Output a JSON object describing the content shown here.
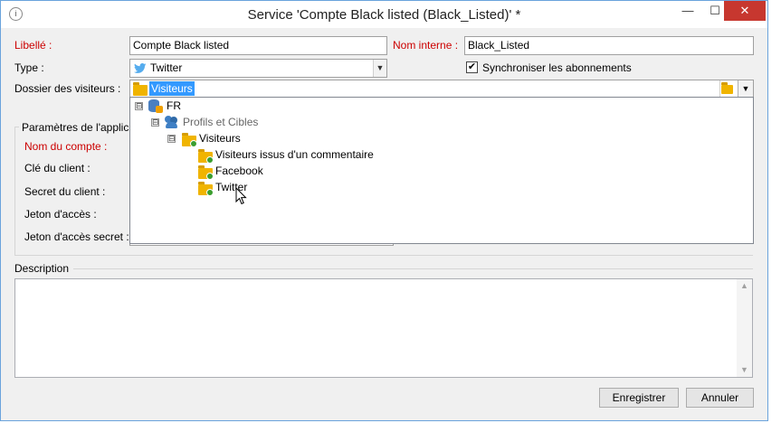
{
  "window": {
    "title": "Service 'Compte Black listed (Black_Listed)' *",
    "app_icon": "info-icon",
    "controls": {
      "minimize": "—",
      "maximize": "☐",
      "close": "✕"
    }
  },
  "form": {
    "libelle_label": "Libellé :",
    "libelle_value": "Compte Black listed",
    "nom_interne_label": "Nom interne :",
    "nom_interne_value": "Black_Listed",
    "type_label": "Type :",
    "type_value": "Twitter",
    "sync_label": "Synchroniser les abonnements",
    "sync_checked": true,
    "dossier_label": "Dossier des visiteurs :",
    "dossier_value": "Visiteurs"
  },
  "app_params": {
    "group_label": "Paramètres de l'applic",
    "nom_compte_label": "Nom du compte :",
    "cle_client_label": "Clé du client :",
    "secret_client_label": "Secret du client :",
    "jeton_label": "Jeton d'accès :",
    "jeton_secret_label": "Jeton d'accès secret :"
  },
  "tree": {
    "root": {
      "label": "FR",
      "expander": "⊟"
    },
    "profils": {
      "label": "Profils et Cibles",
      "expander": "⊟"
    },
    "visiteurs": {
      "label": "Visiteurs",
      "expander": "⊟"
    },
    "children": [
      {
        "label": "Visiteurs issus d'un commentaire"
      },
      {
        "label": "Facebook"
      },
      {
        "label": "Twitter"
      }
    ]
  },
  "description": {
    "label": "Description",
    "value": ""
  },
  "buttons": {
    "save": "Enregistrer",
    "cancel": "Annuler"
  },
  "colors": {
    "required": "#cc0000",
    "selection": "#3399ff",
    "folder": "#f0b400",
    "close_button": "#c7372f"
  }
}
